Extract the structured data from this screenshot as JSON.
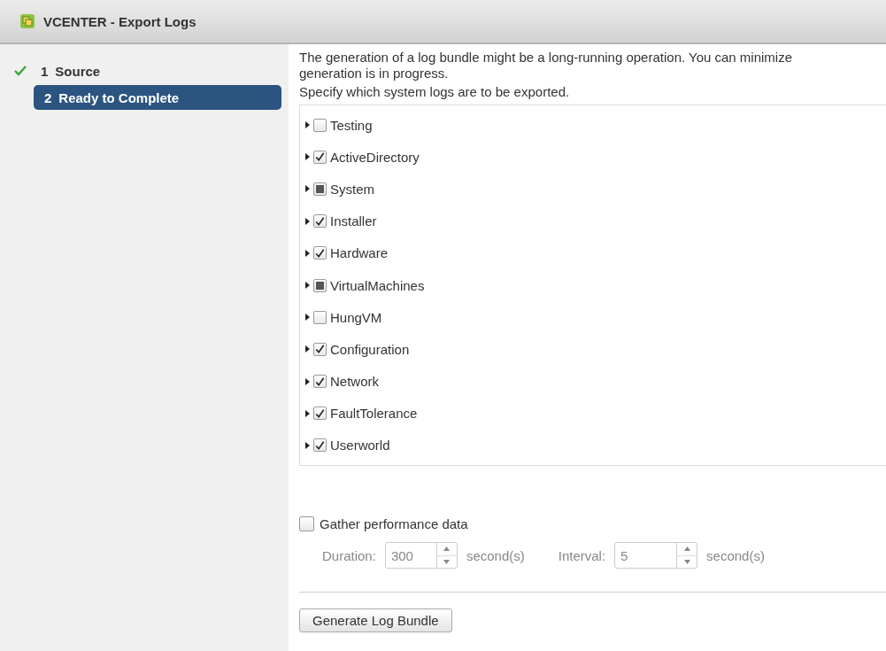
{
  "window": {
    "title": "VCENTER - Export Logs"
  },
  "steps": [
    {
      "number": "1",
      "label": "Source",
      "completed": true,
      "selected": false
    },
    {
      "number": "2",
      "label": "Ready to Complete",
      "completed": false,
      "selected": true
    }
  ],
  "intro": "The generation of a log bundle might be a long-running operation. You can minimize\ngeneration is in progress.",
  "instruction": "Specify which system logs are to be exported.",
  "logs": [
    {
      "label": "Testing",
      "checked": false,
      "partial": false
    },
    {
      "label": "ActiveDirectory",
      "checked": true,
      "partial": false
    },
    {
      "label": "System",
      "checked": false,
      "partial": true
    },
    {
      "label": "Installer",
      "checked": true,
      "partial": false
    },
    {
      "label": "Hardware",
      "checked": true,
      "partial": false
    },
    {
      "label": "VirtualMachines",
      "checked": false,
      "partial": true
    },
    {
      "label": "HungVM",
      "checked": false,
      "partial": false
    },
    {
      "label": "Configuration",
      "checked": true,
      "partial": false
    },
    {
      "label": "Network",
      "checked": true,
      "partial": false
    },
    {
      "label": "FaultTolerance",
      "checked": true,
      "partial": false
    },
    {
      "label": "Userworld",
      "checked": true,
      "partial": false
    }
  ],
  "performance": {
    "label": "Gather performance data",
    "checked": false,
    "disabled": true,
    "fields": [
      {
        "label": "Duration:",
        "value": "300",
        "unit": "second(s)"
      },
      {
        "label": "Interval:",
        "value": "5",
        "unit": "second(s)"
      }
    ]
  },
  "buttons": [
    "Generate Log Bundle"
  ]
}
